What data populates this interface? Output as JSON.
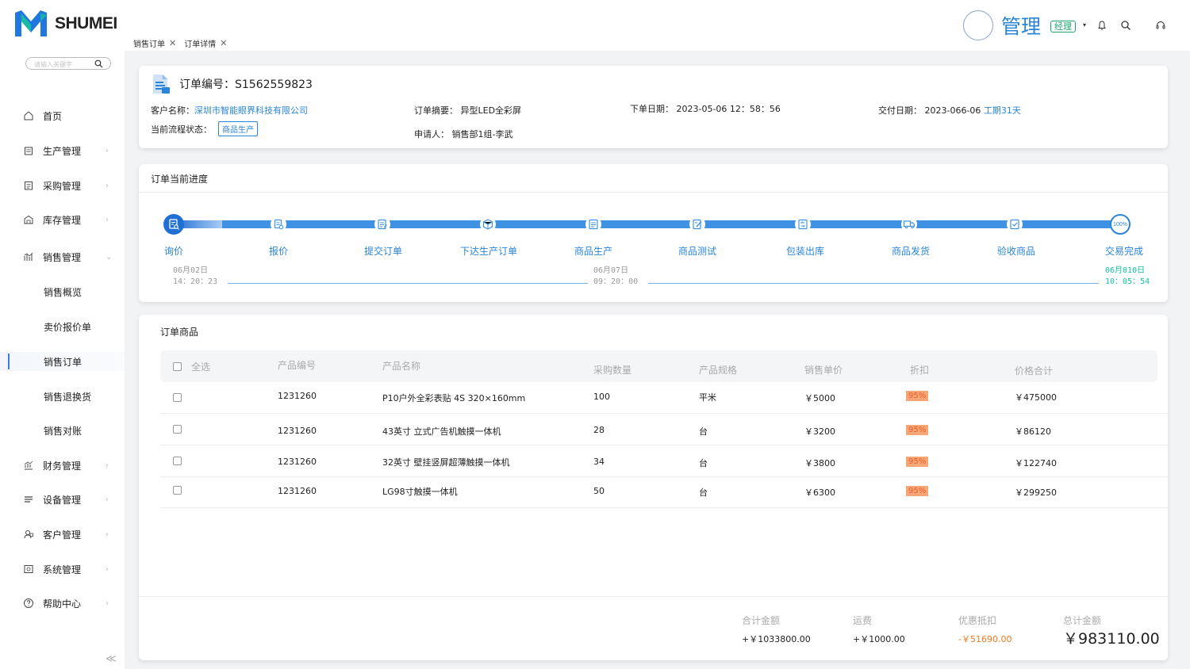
{
  "brand": {
    "name": "SHUMEI",
    "colors": {
      "primary": "#2a85d6",
      "logo_blue": "#1f78e0",
      "logo_teal": "#19c0a0",
      "role_green": "#1fa46e",
      "discount": "#f7a678",
      "done_green": "#19c0a0"
    }
  },
  "tabs": [
    {
      "label": "销售订单",
      "close": "✕"
    },
    {
      "label": "订单详情",
      "close": "✕"
    }
  ],
  "header": {
    "user_name": "管理",
    "role": "经理",
    "caret": "▾",
    "icons": [
      "bell-icon",
      "search-icon",
      "headset-icon"
    ]
  },
  "sidebar": {
    "search_placeholder": "请输入关键字",
    "items": [
      {
        "label": "首页",
        "icon": "home-icon"
      },
      {
        "label": "生产管理",
        "icon": "production-icon",
        "arrow": "›"
      },
      {
        "label": "采购管理",
        "icon": "purchase-icon",
        "arrow": "›"
      },
      {
        "label": "库存管理",
        "icon": "warehouse-icon",
        "arrow": "›"
      },
      {
        "label": "销售管理",
        "icon": "sales-icon",
        "arrow": "⌄"
      },
      {
        "label": "销售概览"
      },
      {
        "label": "卖价报价单"
      },
      {
        "label": "销售订单"
      },
      {
        "label": "销售退换货"
      },
      {
        "label": "销售对账"
      },
      {
        "label": "财务管理",
        "icon": "finance-icon",
        "arrow": "›"
      },
      {
        "label": "设备管理",
        "icon": "device-icon",
        "arrow": "›"
      },
      {
        "label": "客户管理",
        "icon": "customer-icon",
        "arrow": "›"
      },
      {
        "label": "系统管理",
        "icon": "system-icon",
        "arrow": "›"
      },
      {
        "label": "帮助中心",
        "icon": "help-icon",
        "arrow": "›"
      }
    ],
    "collapse": "≪"
  },
  "order": {
    "number_label": "订单编号：",
    "number": "S1562559823",
    "customer_label": "客户名称：",
    "customer": "深圳市智能眼界科技有限公司",
    "summary_label": "订单摘要：",
    "summary": "异型LED全彩屏",
    "order_date_label": "下单日期：",
    "order_date": "2023-05-06 12：58：56",
    "delivery_date_label": "交付日期：",
    "delivery_date": "2023-066-06",
    "period": "工期31天",
    "status_label": "当前流程状态：",
    "status": "商品生产",
    "applicant_label": "申请人：",
    "applicant": "销售部1组-李武"
  },
  "progress": {
    "title": "订单当前进度",
    "steps": [
      "询价",
      "报价",
      "提交订单",
      "下达生产订单",
      "商品生产",
      "商品测试",
      "包装出库",
      "商品发货",
      "验收商品",
      "交易完成"
    ],
    "percent_label": "100%",
    "timestamps": [
      {
        "date": "06月02日",
        "time": "14：20：23"
      },
      {
        "date": "06月07日",
        "time": "09：20：00"
      },
      {
        "date": "06月010日",
        "time": "10：05：54"
      }
    ]
  },
  "products": {
    "title": "订单商品",
    "select_all": "全选",
    "headers": [
      "产品编号",
      "产品名称",
      "采购数量",
      "产品规格",
      "销售单价",
      "折扣",
      "价格合计"
    ],
    "rows": [
      {
        "code": "1231260",
        "name": "P10户外全彩表贴 4S 320×160mm",
        "qty": "100",
        "spec": "平米",
        "price": "￥5000",
        "discount": "95%",
        "total": "￥475000"
      },
      {
        "code": "1231260",
        "name": "43英寸 立式广告机触摸一体机",
        "qty": "28",
        "spec": "台",
        "price": "￥3200",
        "discount": "95%",
        "total": "￥86120"
      },
      {
        "code": "1231260",
        "name": "32英寸 壁挂竖屏超薄触摸一体机",
        "qty": "34",
        "spec": "台",
        "price": "￥3800",
        "discount": "95%",
        "total": "￥122740"
      },
      {
        "code": "1231260",
        "name": "LG98寸触摸一体机",
        "qty": "50",
        "spec": "台",
        "price": "￥6300",
        "discount": "95%",
        "total": "￥299250"
      }
    ]
  },
  "summary": {
    "subtotal_label": "合计金额",
    "subtotal": "+￥1033800.00",
    "shipping_label": "运费",
    "shipping": "+￥1000.00",
    "discount_label": "优惠抵扣",
    "discount": "-￥51690.00",
    "total_label": "总计金额",
    "total": "￥983110.00"
  }
}
